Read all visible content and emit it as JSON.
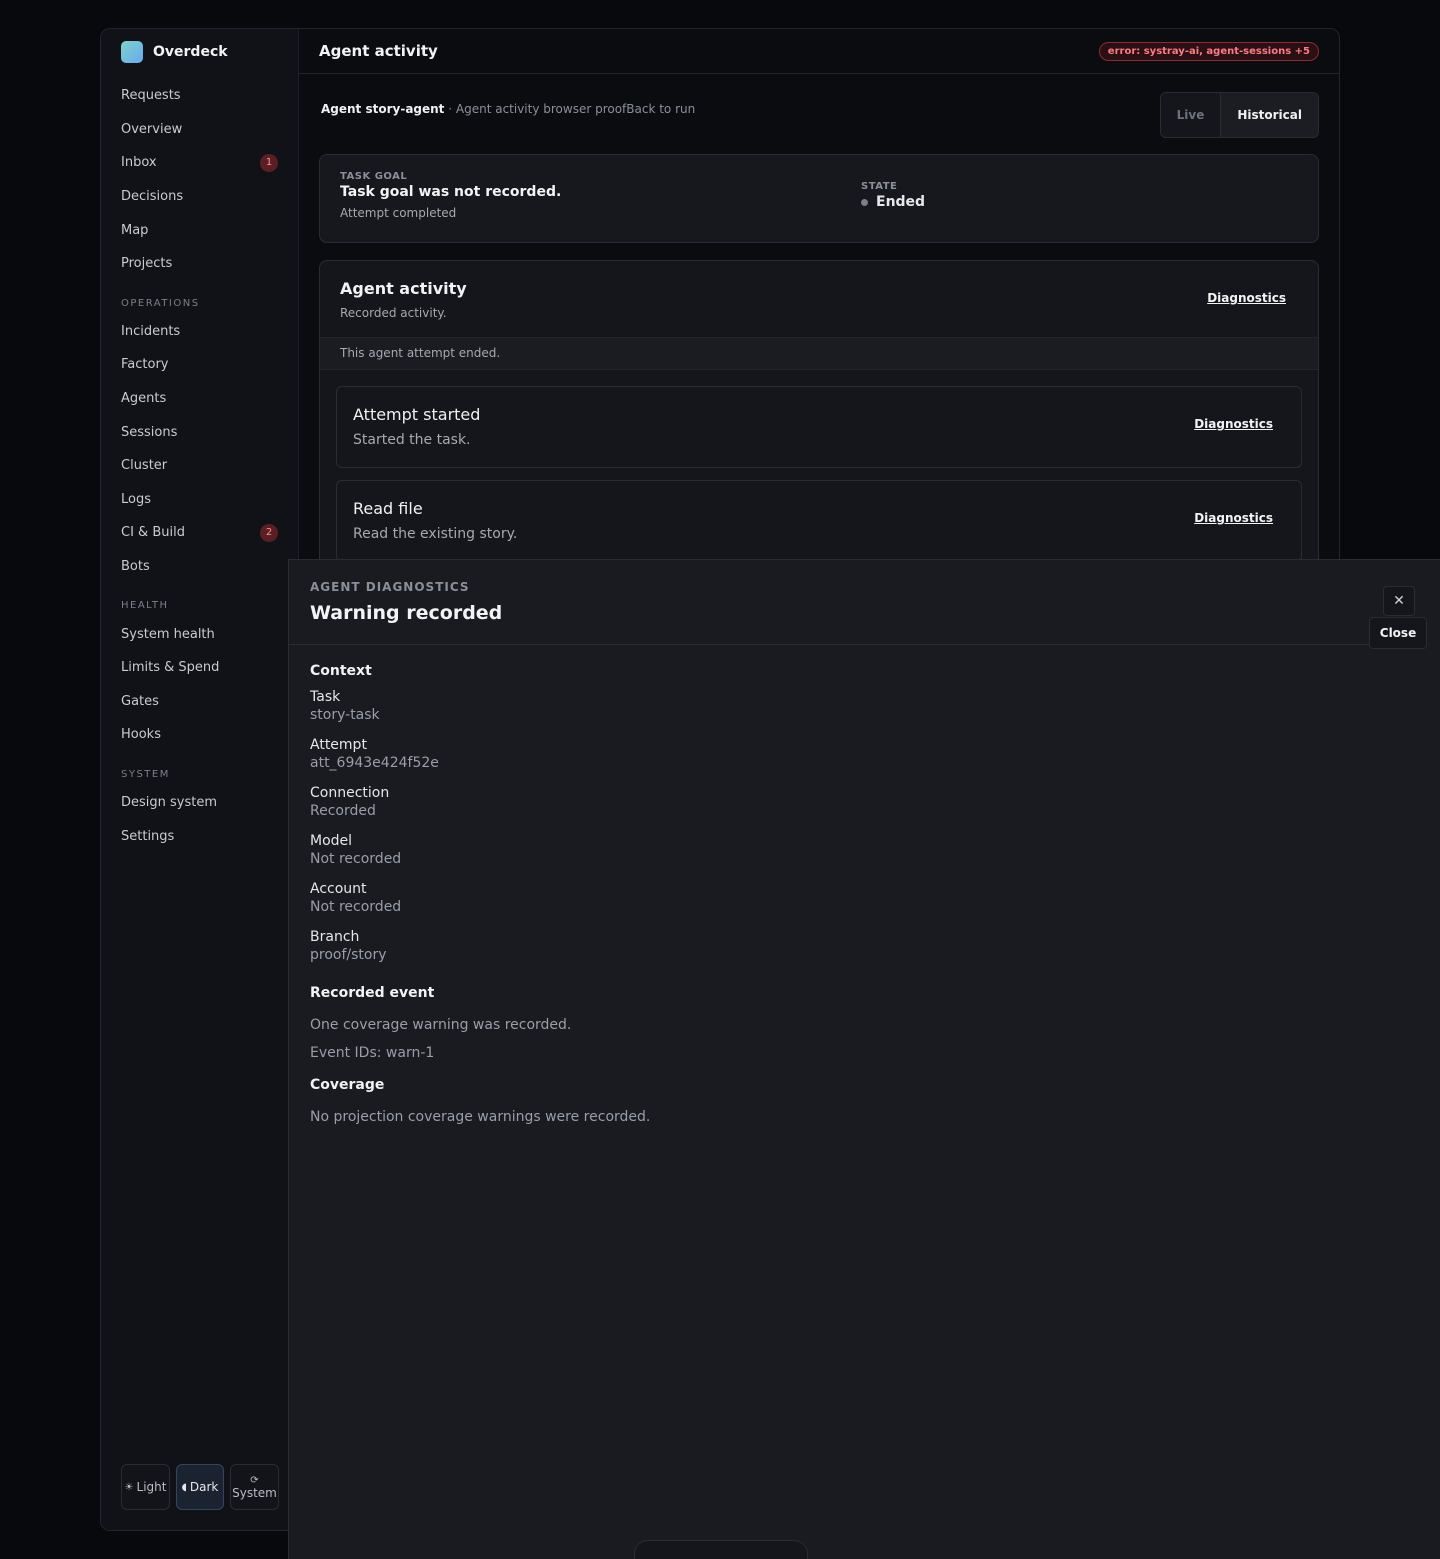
{
  "app": {
    "name": "Overdeck"
  },
  "header": {
    "title": "Agent activity",
    "error_pill": "error: systray-ai, agent-sessions +5"
  },
  "sidebar": {
    "items": [
      {
        "label": "Requests"
      },
      {
        "label": "Overview"
      },
      {
        "label": "Inbox",
        "badge": "1"
      },
      {
        "label": "Decisions"
      },
      {
        "label": "Map"
      },
      {
        "label": "Projects"
      }
    ],
    "operations_label": "OPERATIONS",
    "operations": [
      {
        "label": "Incidents"
      },
      {
        "label": "Factory"
      },
      {
        "label": "Agents"
      },
      {
        "label": "Sessions"
      },
      {
        "label": "Cluster"
      },
      {
        "label": "Logs"
      },
      {
        "label": "CI & Build",
        "badge": "2"
      },
      {
        "label": "Bots"
      }
    ],
    "health_label": "HEALTH",
    "health": [
      {
        "label": "System health"
      },
      {
        "label": "Limits & Spend"
      },
      {
        "label": "Gates"
      },
      {
        "label": "Hooks"
      }
    ],
    "system_label": "SYSTEM",
    "system": [
      {
        "label": "Design system"
      },
      {
        "label": "Settings"
      }
    ],
    "theme": {
      "light": "Light",
      "dark": "Dark",
      "system": "System",
      "selected": "Dark"
    }
  },
  "subheader": {
    "agent": "Agent story-agent",
    "context": "· Agent activity browser proof",
    "back_link": "Back to run",
    "mode_live": "Live",
    "mode_historical": "Historical",
    "selected_mode": "Historical"
  },
  "goal": {
    "eyebrow": "TASK GOAL",
    "title": "Task goal was not recorded.",
    "sub": "Attempt completed",
    "state_label": "STATE",
    "state_value": "Ended"
  },
  "activity": {
    "title": "Agent activity",
    "subtitle": "Recorded activity.",
    "diagnostics": "Diagnostics",
    "notice": "This agent attempt ended.",
    "events": [
      {
        "title": "Attempt started",
        "sub": "Started the task.",
        "link": "Diagnostics"
      },
      {
        "title": "Read file",
        "sub": "Read the existing story.",
        "link": "Diagnostics"
      }
    ]
  },
  "drawer": {
    "eyebrow": "AGENT DIAGNOSTICS",
    "title": "Warning recorded",
    "close_icon": "close-icon",
    "close_tooltip": "Close",
    "context_title": "Context",
    "context": [
      {
        "key": "Task",
        "value": "story-task"
      },
      {
        "key": "Attempt",
        "value": "att_6943e424f52e"
      },
      {
        "key": "Connection",
        "value": "Recorded"
      },
      {
        "key": "Model",
        "value": "Not recorded"
      },
      {
        "key": "Account",
        "value": "Not recorded"
      },
      {
        "key": "Branch",
        "value": "proof/story"
      }
    ],
    "event_title": "Recorded event",
    "event_text": "One coverage warning was recorded.",
    "event_ids": "Event IDs: warn-1",
    "coverage_title": "Coverage",
    "coverage_text": "No projection coverage warnings were recorded."
  },
  "colors": {
    "accent": "#6aa8f0",
    "error": "#ff7b84",
    "background": "#08090d"
  }
}
